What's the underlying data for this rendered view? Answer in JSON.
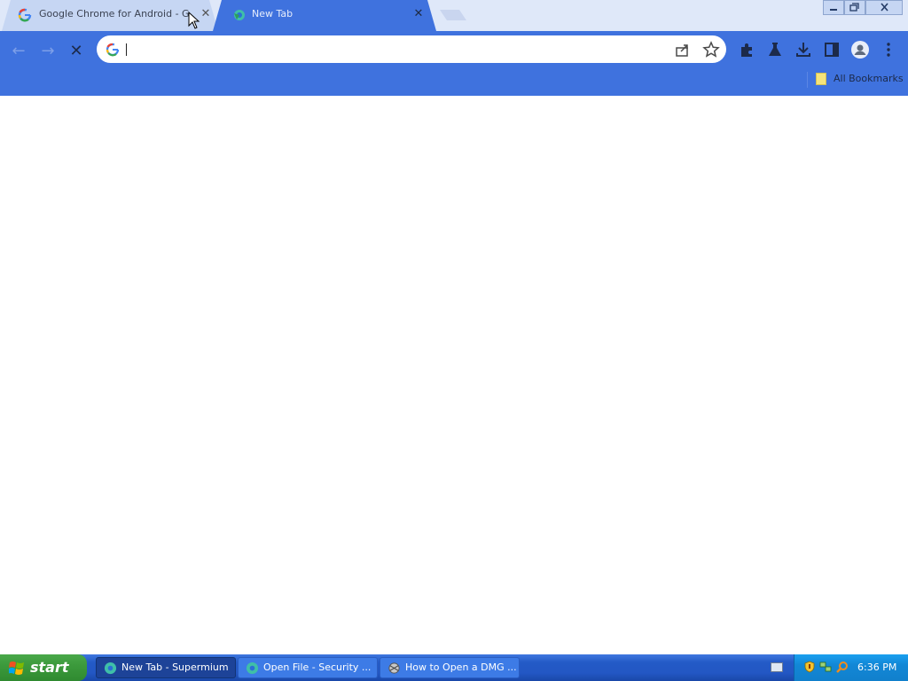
{
  "tabs": [
    {
      "title": "Google Chrome for Android - Google",
      "close_glyph": "✕",
      "icon": "google-g-icon"
    },
    {
      "title": "New Tab",
      "close_glyph": "✕",
      "icon": "supermium-icon"
    }
  ],
  "toolbar": {
    "back_glyph": "←",
    "forward_glyph": "→",
    "stop_glyph": "✕",
    "omnibox_value": "",
    "omnibox_placeholder": ""
  },
  "bookmarks_bar": {
    "all_bookmarks_label": "All Bookmarks"
  },
  "taskbar": {
    "start_label": "start",
    "buttons": [
      {
        "label": "New Tab - Supermium",
        "icon": "supermium-icon"
      },
      {
        "label": "Open File - Security ...",
        "icon": "supermium-icon"
      },
      {
        "label": "How to Open a DMG ...",
        "icon": "app-icon"
      }
    ],
    "clock": "6:36 PM"
  },
  "colors": {
    "theme": "#3f72de",
    "tab_strip": "#dfe8f9",
    "taskbar": "#235ac6",
    "start": "#3c9a3c"
  }
}
